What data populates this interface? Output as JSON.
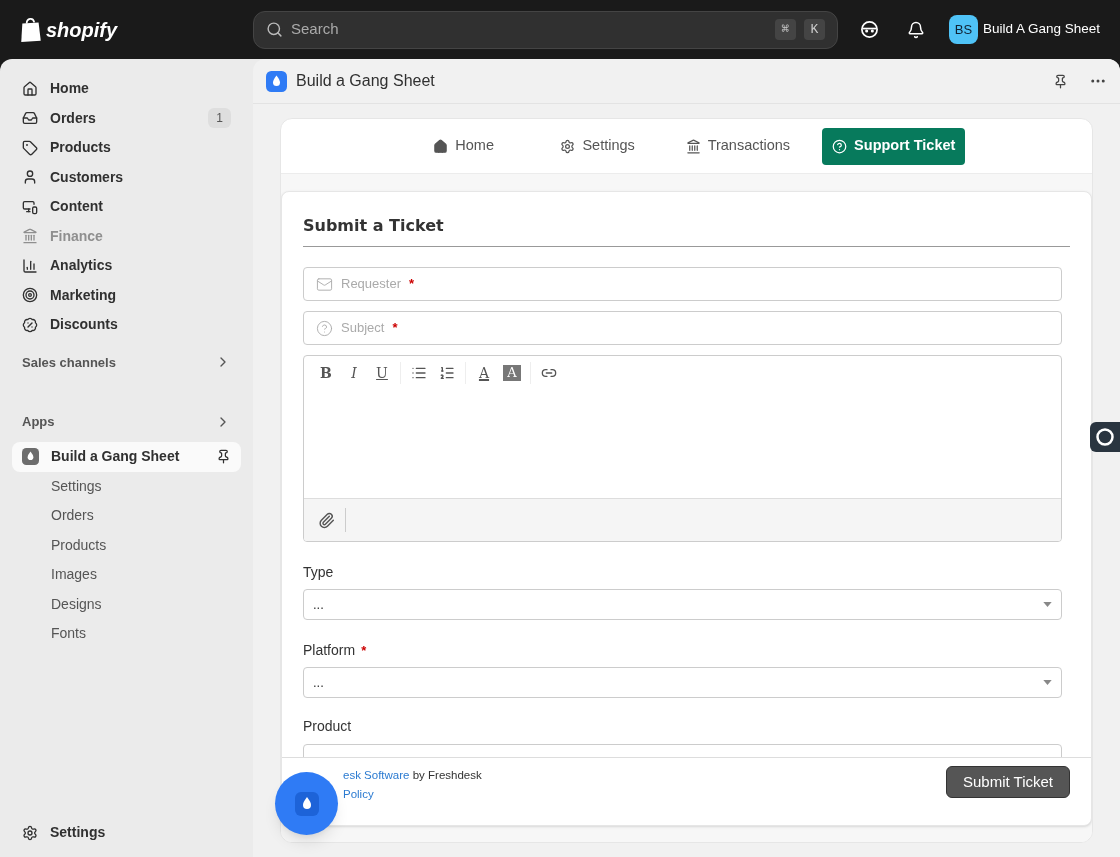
{
  "topbar": {
    "logo": "shopify",
    "search": {
      "placeholder": "Search"
    },
    "shortcut_keys": [
      "⌘",
      "K"
    ],
    "store": {
      "initials": "BS",
      "name": "Build A Gang Sheet"
    }
  },
  "sidebar": {
    "items": [
      {
        "label": "Home",
        "disabled": false
      },
      {
        "label": "Orders",
        "disabled": false,
        "badge": "1"
      },
      {
        "label": "Products",
        "disabled": false
      },
      {
        "label": "Customers",
        "disabled": false
      },
      {
        "label": "Content",
        "disabled": false
      },
      {
        "label": "Finance",
        "disabled": true
      },
      {
        "label": "Analytics",
        "disabled": false
      },
      {
        "label": "Marketing",
        "disabled": false
      },
      {
        "label": "Discounts",
        "disabled": false
      }
    ],
    "sections": [
      "Sales channels",
      "Apps"
    ],
    "app": {
      "label": "Build a Gang Sheet",
      "selected": true
    },
    "app_subitems": [
      "Settings",
      "Orders",
      "Products",
      "Images",
      "Designs",
      "Fonts"
    ],
    "footer_item": "Settings"
  },
  "page": {
    "title": "Build a Gang Sheet"
  },
  "tabs": [
    {
      "label": "Home",
      "selected": false
    },
    {
      "label": "Settings",
      "selected": false
    },
    {
      "label": "Transactions",
      "selected": false
    },
    {
      "label": "Support Ticket",
      "selected": true
    }
  ],
  "form": {
    "title": "Submit a Ticket",
    "inputs": [
      {
        "kind": "email",
        "placeholder": "Requester",
        "required_mark": "*"
      },
      {
        "kind": "question",
        "placeholder": "Subject",
        "required_mark": "*"
      }
    ],
    "toolbar": [
      [
        {
          "kind": "bold",
          "label": "B"
        },
        {
          "kind": "italic",
          "label": "I"
        },
        {
          "kind": "underline",
          "label": "U"
        }
      ],
      [
        {
          "kind": "bullets"
        },
        {
          "kind": "numbers"
        }
      ],
      [
        {
          "kind": "font-color",
          "label": "A"
        },
        {
          "kind": "bg-color",
          "label": "A"
        }
      ],
      [
        {
          "kind": "link"
        }
      ]
    ],
    "selects": [
      {
        "label": "Type",
        "value": "..."
      },
      {
        "label": "Platform",
        "required_mark": "*",
        "value": "..."
      }
    ],
    "cut_field_label": "Product",
    "footer": {
      "powered_link": "esk Software",
      "powered_by": "by Freshdesk",
      "policy_link": "Policy"
    },
    "submit": "Submit Ticket"
  }
}
